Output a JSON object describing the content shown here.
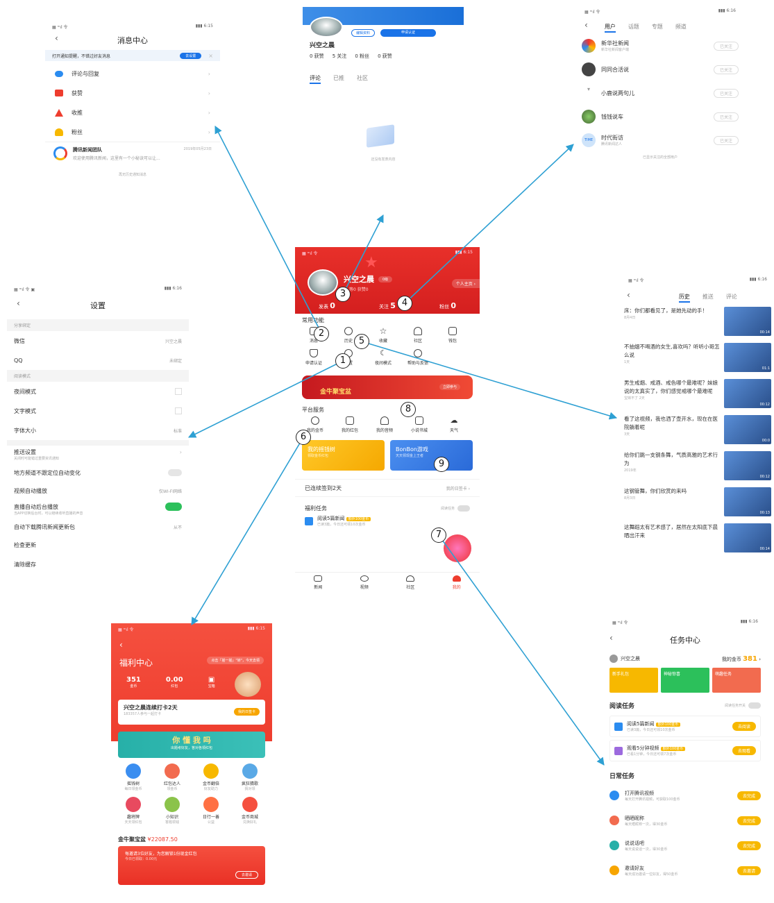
{
  "arrows_color": "#2ea0d3",
  "accent_red": "#ee3d2e",
  "accent_blue": "#1a73e8",
  "center": {
    "status_left": "▦ ᵐıl 令 ",
    "status_right": "▮▮▮ 6:15",
    "username": "兴空之晨",
    "badge": "0级",
    "sub_stats": "等0  获赞0",
    "profile_link": "个人主页 ›",
    "stats": [
      {
        "label": "发表",
        "value": "0"
      },
      {
        "label": "关注",
        "value": "5"
      },
      {
        "label": "粉丝",
        "value": "0"
      }
    ],
    "section_common": "常用功能",
    "common_items": [
      "消息",
      "历史",
      "收藏",
      "社区",
      "钱包",
      "申请认证",
      "设置",
      "夜间模式",
      "帮助与反馈"
    ],
    "banner_title": "金牛聚宝盆",
    "banner_tag": "立即参与",
    "section_platform": "平台服务",
    "platform_items": [
      "我的金币",
      "我的红包",
      "我的音频",
      "小说书城",
      "天气"
    ],
    "card_left": "我的摇钱树",
    "card_left_sub": "领取金币红包",
    "card_right": "BonBon游戏",
    "card_right_sub": "天天领现金上王者",
    "signin": "已连续签到2天",
    "signin_link": "我的日签卡 ›",
    "welfare_title": "福利任务",
    "welfare_toggle": "阅读任务",
    "welfare_task": "阅读5篇新闻",
    "welfare_tag": "额外100金币",
    "welfare_sub": "已读3篇，今日还可领10次金币",
    "bottom_nav": [
      "新闻",
      "视频",
      "社区",
      "我的"
    ]
  },
  "messages": {
    "status_left": "▦ ᵐıl 令 ",
    "status_right": "▮▮▮ 6:15",
    "title": "消息中心",
    "notice": "打开通知提醒，不错过好友消息",
    "notice_btn": "去设置",
    "items": [
      "评论与回复",
      "获赞",
      "收推",
      "粉丝"
    ],
    "news_name": "腾讯新闻团队",
    "news_time": "2019年05月23日",
    "news_text": "欢迎使用腾讯新闻，这里有一个小秘诀可以让...",
    "footer": "再无历史通知消息"
  },
  "profile_top": {
    "btn1": "编辑资料",
    "btn2": "申请认证",
    "name": "兴空之晨",
    "stats": [
      "0 获赞",
      "5 关注",
      "0 粉丝",
      "0 获赞"
    ],
    "tabs": [
      "评论",
      "已推",
      "社区"
    ],
    "empty": "还没有发表内容"
  },
  "follows": {
    "status_left": "▦ ᵐıl 令 ",
    "status_right": "▮▮▮ 6:16",
    "tabs": [
      "用户",
      "话题",
      "专题",
      "频道"
    ],
    "users": [
      {
        "name": "新华社新闻",
        "sub": "新华社新闻客户端",
        "btn": "已关注"
      },
      {
        "name": "同同合活说",
        "sub": "",
        "btn": "已关注"
      },
      {
        "name": "小鹿说两句儿",
        "sub": "",
        "btn": "已关注"
      },
      {
        "name": "钱钱说车",
        "sub": "",
        "btn": "已关注"
      },
      {
        "name": "时代街访",
        "sub": "腾讯新闻达人",
        "btn": "已关注"
      }
    ],
    "footer": "已显示关注的全部用户"
  },
  "settings": {
    "status_left": "▦ ᵐıl 令 ▣",
    "status_right": "▮▮▮ 6:16",
    "title": "设置",
    "group1": "分享绑定",
    "wechat": "微信",
    "wechat_val": "兴空之晨",
    "qq": "QQ",
    "qq_val": "未绑定",
    "group2": "阅读模式",
    "night": "夜间模式",
    "text_mode": "文字模式",
    "font": "字体大小",
    "font_val": "标准",
    "push": "推送设置",
    "push_sub": "关闭时可能错过重要资讯通知",
    "location": "地方频道不跟定位自动变化",
    "video": "视频自动播放",
    "video_val": "仅WI-FI网络",
    "bg": "直播自动后台播放",
    "bg_sub": "当APP切换后台时，可以继续收听直播的声音",
    "download": "自动下载腾讯新闻更新包",
    "download_val": "从不",
    "update": "检查更新",
    "cache": "清除缓存"
  },
  "history": {
    "status_left": "▦ ᵐıl 令 ",
    "status_right": "▮▮▮ 6:16",
    "tabs": [
      "历史",
      "推送",
      "评论"
    ],
    "items": [
      {
        "title": "床：你们都看见了，是她先动的手！",
        "meta": "8月4日",
        "dur": "00:14"
      },
      {
        "title": "不抽烟不喝酒的女生,喜欢吗？听听小哥怎么说",
        "meta": "1天",
        "dur": "01:1"
      },
      {
        "title": "男生戒烟、戒酒、戒色哪个最难呢？妹娘说的太真实了，你们感觉戒哪个最难呢",
        "meta": "宝妹不了 2天",
        "dur": "00:12"
      },
      {
        "title": "看了这视频，我也洒了壶开水，现在在医院躺着呢",
        "meta": "3天",
        "dur": "00:0"
      },
      {
        "title": "给你们跳一支钢条舞，气质高雅的艺术行为",
        "meta": "2019年",
        "dur": "00:12"
      },
      {
        "title": "这钢管舞，你们欣赏的来吗",
        "meta": "8月3日",
        "dur": "00:13"
      },
      {
        "title": "这舞蹈太有艺术感了，居然在太阳底下晨晒出汗来",
        "meta": "",
        "dur": "00:14"
      }
    ]
  },
  "welfare": {
    "status_left": "▦ ᵐıl 令 ",
    "status_right": "▮▮▮ 6:15",
    "title": "福利中心",
    "tip": "点击「摇一摇」\"转\"，今天去领",
    "coins": "351",
    "coins_label": "金币",
    "cash": "0.00",
    "cash_label": "红包",
    "open_box": "宝箱",
    "checkin": "兴空之晨连续打卡2天",
    "checkin_sub": "183357人参与一起打卡",
    "checkin_btn": "我的日签卡",
    "game_banner": "你 懂 我 吗",
    "game_sub": "出题考好友，答对各领红包",
    "grid": [
      "摇钱树",
      "红包达人",
      "金币翻倍",
      "疯狂猜歌",
      "趣将牌",
      "小知识",
      "日行一善",
      "金币商城"
    ],
    "grid_subs": [
      "每日领金币",
      "领金币",
      "好友助力",
      "猜对领",
      "天天领红包",
      "答题领钱",
      "公益",
      "兑换好礼"
    ],
    "pot_title": "金牛聚宝盆",
    "pot_value": "¥22087.50",
    "pot_text": "每邀请3位好友，为您解锁1份现金红包",
    "pot_sub": "今日已领取：0.00元",
    "pot_btn": "去邀请"
  },
  "tasks": {
    "status_left": "▦ ᵐıl 令 ",
    "status_right": "▮▮▮ 6:16",
    "title": "任务中心",
    "user": "兴空之晨",
    "coins_label": "我的金币",
    "coins": "381",
    "cards": [
      "新手礼包",
      "神秘惊喜",
      "萌趣任务"
    ],
    "read_title": "阅读任务",
    "read_toggle": "阅读任务开关",
    "read_tasks": [
      {
        "name": "阅读5篇新闻",
        "tag": "额外100金币",
        "sub": "已读3篇，今日还可领10次金币",
        "btn": "去阅读"
      },
      {
        "name": "观看5分钟视频",
        "tag": "额外100金币",
        "sub": "已看1分钟，今日还可领7次金币",
        "btn": "去观看"
      }
    ],
    "daily_title": "日常任务",
    "daily_tasks": [
      {
        "name": "打开腾讯视频",
        "sub": "每天打开腾讯视频，可获取100金币",
        "btn": "去完成"
      },
      {
        "name": "晒晒昵称",
        "sub": "每天晒昵称一次，得30金币",
        "btn": "去完成"
      },
      {
        "name": "说说话吧",
        "sub": "每天说说话一次，得30金币",
        "btn": "去完成"
      },
      {
        "name": "邀请好友",
        "sub": "每天成功邀请一位好友，得50金币",
        "btn": "去邀请"
      }
    ]
  },
  "callouts": [
    "1",
    "2",
    "3",
    "4",
    "5",
    "6",
    "7",
    "8",
    "9"
  ]
}
